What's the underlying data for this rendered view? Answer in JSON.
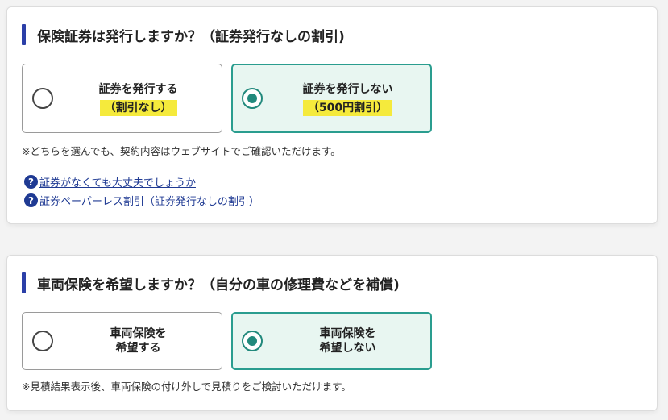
{
  "section1": {
    "title": "保険証券は発行しますか？（証券発行なしの割引)",
    "option_issue": {
      "line1": "証券を発行する",
      "line2": "（割引なし）",
      "selected": false
    },
    "option_no_issue": {
      "line1": "証券を発行しない",
      "line2": "（500円割引）",
      "selected": true
    },
    "note": "※どちらを選んでも、契約内容はウェブサイトでご確認いただけます。",
    "help_links": [
      {
        "icon": "question-circle-icon",
        "text": "証券がなくても大丈夫でしょうか"
      },
      {
        "icon": "question-circle-icon",
        "text": "証券ペーパーレス割引（証券発行なしの割引）"
      }
    ]
  },
  "section2": {
    "title": "車両保険を希望しますか？（自分の車の修理費などを補償)",
    "option_want": {
      "line1": "車両保険を",
      "line2": "希望する",
      "selected": false
    },
    "option_not_want": {
      "line1": "車両保険を",
      "line2": "希望しない",
      "selected": true
    },
    "note": "※見積結果表示後、車両保険の付け外しで見積りをご検討いただけます。"
  },
  "colors": {
    "accent_bar": "#2b3fa8",
    "selected_border": "#2a9d8f",
    "selected_bg": "#e8f6f1",
    "highlight": "#f5ea3c",
    "link": "#1f3a93"
  }
}
